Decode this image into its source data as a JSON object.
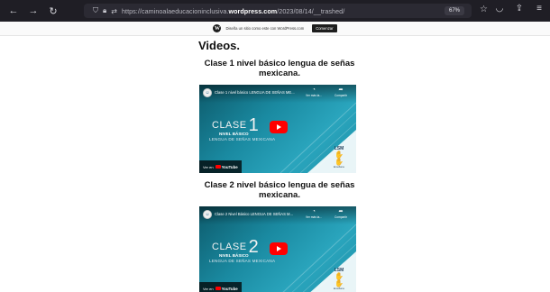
{
  "browser": {
    "url_prefix": "https://caminoalaeducacioninclusiva.",
    "url_domain": "wordpress.com",
    "url_path": "/2023/08/14/__trashed/",
    "zoom": "67%"
  },
  "wp_banner": {
    "logo": "W",
    "text": "Diseña un sitio como este con WordPress.com",
    "button": "Comenzar"
  },
  "page": {
    "heading": "Videos.",
    "videos": [
      {
        "title": "Clase 1 nivel básico lengua de señas mexicana.",
        "embed_title": "Clase 1 nivel básico LENGUA DE SEÑAS ME...",
        "watch_later": "Ver más ta...",
        "share": "Compartir",
        "clase_word": "CLASE",
        "clase_num": "1",
        "nivel": "NIVEL BÁSICO",
        "lengua": "LENGUA DE SEÑAS MEXICANA",
        "logo_text": "LSM",
        "logo_sub": "Enséñame",
        "watch_on": "Ver en",
        "youtube": "YouTube"
      },
      {
        "title": "Clase 2 nivel básico lengua de señas mexicana.",
        "embed_title": "Clase 2 Nivel Básico LENGUA DE SEÑAS M...",
        "watch_later": "Ver más ta...",
        "share": "Compartir",
        "clase_word": "CLASE",
        "clase_num": "2",
        "nivel": "NIVEL BÁSICO",
        "lengua": "LENGUA DE SEÑAS MEXICANA",
        "logo_text": "LSM",
        "logo_sub": "Enséñame",
        "watch_on": "Ver en",
        "youtube": "YouTube"
      }
    ]
  },
  "colors": {
    "toolbar_bg": "#1f1e25",
    "youtube_red": "#ff0000",
    "embed_teal": "#1a8aa1"
  }
}
